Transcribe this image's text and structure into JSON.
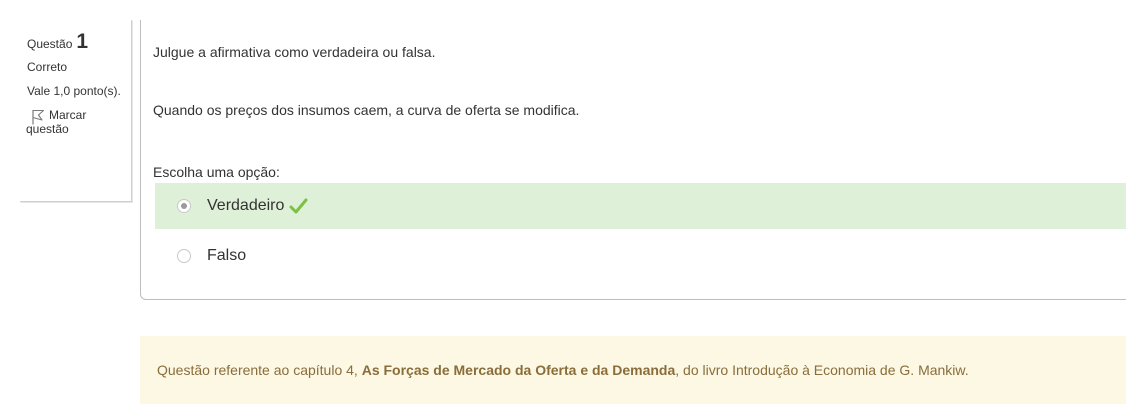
{
  "info": {
    "question_label": "Questão",
    "question_number": "1",
    "state": "Correto",
    "grade": "Vale 1,0 ponto(s).",
    "flag_line1": "Marcar",
    "flag_line2": "questão"
  },
  "question": {
    "prompt": "Julgue a afirmativa como verdadeira ou falsa.",
    "text": "Quando os preços dos insumos caem, a curva de oferta se modifica.",
    "choose_label": "Escolha uma opção:",
    "options": [
      {
        "label": "Verdadeiro",
        "selected": true,
        "correct": true
      },
      {
        "label": "Falso",
        "selected": false,
        "correct": false
      }
    ]
  },
  "feedback": {
    "prefix": "Questão referente ao capítulo 4, ",
    "chapter_title": "As Forças de Mercado da Oferta e da Demanda",
    "suffix": ", do livro Introdução à Economia de G. Mankiw."
  },
  "colors": {
    "correct_bg": "#dff0d8",
    "feedback_bg": "#fcf8e3",
    "feedback_text": "#8a6d3b",
    "check_green": "#7cc142"
  }
}
